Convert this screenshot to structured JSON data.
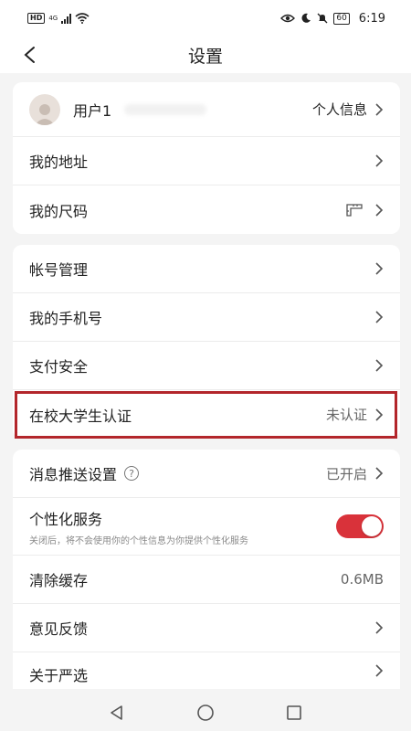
{
  "status_bar": {
    "hd": "HD",
    "network": "4G",
    "battery": "60",
    "time": "6:19"
  },
  "nav": {
    "title": "设置"
  },
  "profile": {
    "username": "用户1",
    "info_label": "个人信息"
  },
  "group1": {
    "address": "我的地址",
    "size": "我的尺码"
  },
  "group2": {
    "account": "帐号管理",
    "phone": "我的手机号",
    "payment": "支付安全",
    "student": "在校大学生认证",
    "student_status": "未认证"
  },
  "group3": {
    "push": "消息推送设置",
    "push_status": "已开启",
    "personal": "个性化服务",
    "personal_desc": "关闭后，将不会使用你的个性信息为你提供个性化服务",
    "cache": "清除缓存",
    "cache_size": "0.6MB",
    "feedback": "意见反馈",
    "about": "关于严选"
  },
  "colors": {
    "accent": "#d9323a",
    "highlight_border": "#b3262b"
  },
  "toggle_personal_on": true
}
